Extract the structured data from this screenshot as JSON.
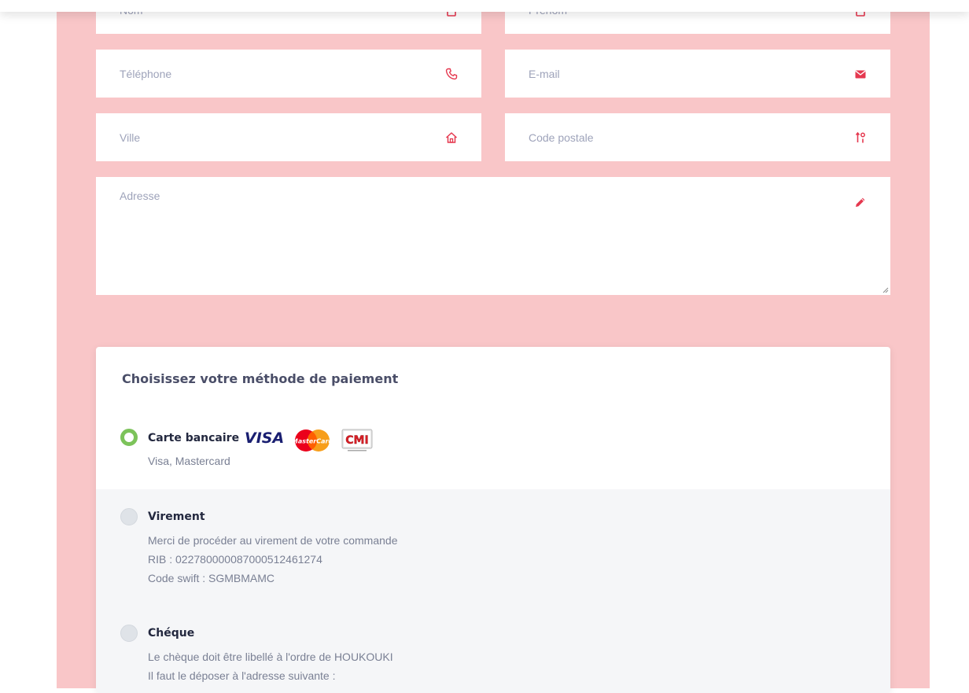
{
  "form": {
    "nom_placeholder": "Nom",
    "prenom_placeholder": "Prénom",
    "telephone_placeholder": "Téléphone",
    "email_placeholder": "E-mail",
    "ville_placeholder": "Ville",
    "code_postal_placeholder": "Code postale",
    "adresse_placeholder": "Adresse",
    "icons": {
      "nom": "user-icon",
      "prenom": "user-icon",
      "telephone": "phone-icon",
      "email": "envelope-icon",
      "ville": "home-icon",
      "code_postal": "sort-numeric-icon",
      "adresse": "pencil-icon"
    }
  },
  "payment": {
    "title": "Choisissez votre méthode de paiement",
    "options": [
      {
        "label": "Carte bancaire",
        "selected": true,
        "description": [
          "Visa, Mastercard"
        ],
        "logos": [
          "visa-logo",
          "mastercard-logo",
          "cmi-logo"
        ]
      },
      {
        "label": "Virement",
        "selected": false,
        "description": [
          "Merci de procéder au virement de votre commande",
          "RIB : 022780000087000512461274",
          "Code swift : SGMBMAMC"
        ]
      },
      {
        "label": "Chéque",
        "selected": false,
        "description": [
          "Le chèque doit être libellé à l'ordre de HOUKOUKI",
          "Il faut le déposer à l'adresse suivante :"
        ]
      }
    ]
  },
  "colors": {
    "panel_bg": "#f9c6c8",
    "icon_red": "#e5384f",
    "radio_selected": "#7cc35a",
    "option_gray_bg": "#f5f6f8",
    "visa_blue": "#1a1f71"
  },
  "logos_text": {
    "visa": "VISA",
    "mastercard": "MasterCard",
    "cmi": "CMI"
  }
}
